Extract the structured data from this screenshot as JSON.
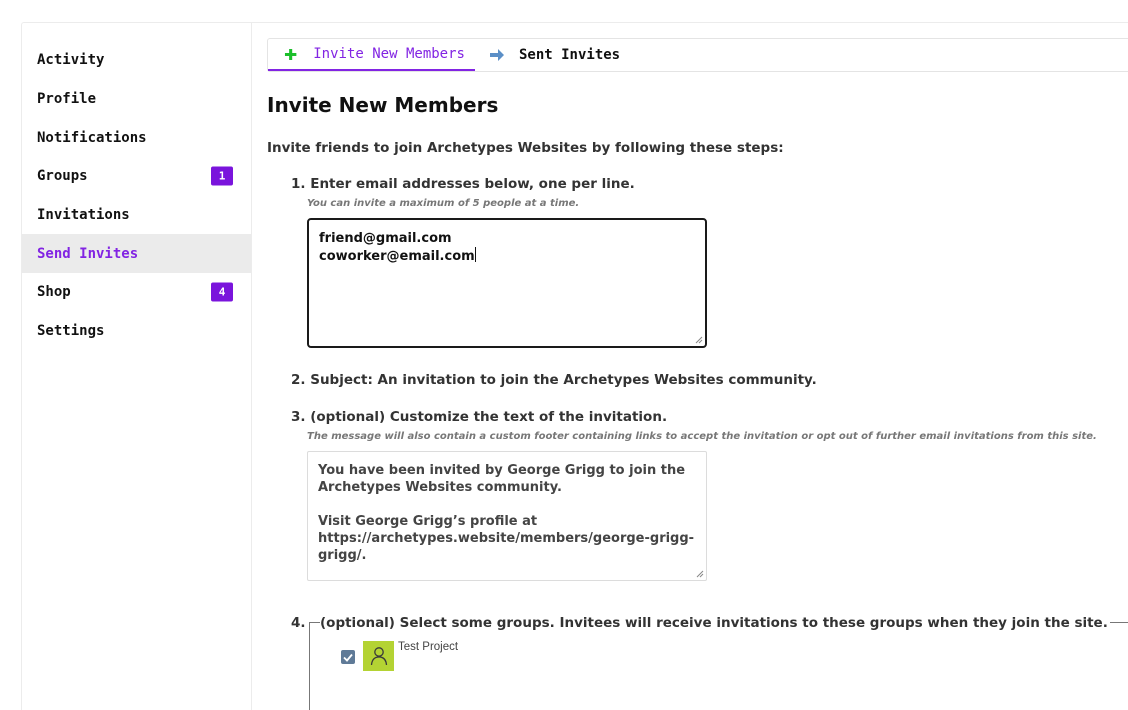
{
  "sidebar": {
    "items": [
      {
        "label": "Activity"
      },
      {
        "label": "Profile"
      },
      {
        "label": "Notifications"
      },
      {
        "label": "Groups",
        "badge": "1"
      },
      {
        "label": "Invitations"
      },
      {
        "label": "Send Invites",
        "active": true
      },
      {
        "label": "Shop",
        "badge": "4"
      },
      {
        "label": "Settings"
      }
    ]
  },
  "tabs": {
    "current": "Invite New Members",
    "next": "Sent Invites"
  },
  "page": {
    "title": "Invite New Members",
    "intro": "Invite friends to join Archetypes Websites by following these steps:"
  },
  "steps": {
    "step1": {
      "label": "1. Enter email addresses below, one per line.",
      "hint": "You can invite a maximum of 5 people at a time.",
      "emails": [
        "friend@gmail.com",
        "coworker@email.com"
      ]
    },
    "step2": {
      "label": "2. Subject: An invitation to join the Archetypes Websites community."
    },
    "step3": {
      "label": "3. (optional) Customize the text of the invitation.",
      "hint": "The message will also contain a custom footer containing links to accept the invitation or opt out of further email invitations from this site.",
      "message_p1": "You have been invited by George Grigg to join the Archetypes Websites community.",
      "message_p2": "Visit George Grigg’s profile at https://archetypes.website/members/george-grigg-grigg/."
    },
    "step4": {
      "number": "4.",
      "legend": "(optional) Select some groups. Invitees will receive invitations to these groups when they join the site.",
      "groups": [
        {
          "name": "Test Project",
          "checked": true
        }
      ]
    }
  },
  "colors": {
    "accent": "#8224e3",
    "badge": "#7a14dc",
    "plus": "#1bbf2a",
    "arrow": "#5b8fc7",
    "group_avatar": "#b4d333"
  }
}
